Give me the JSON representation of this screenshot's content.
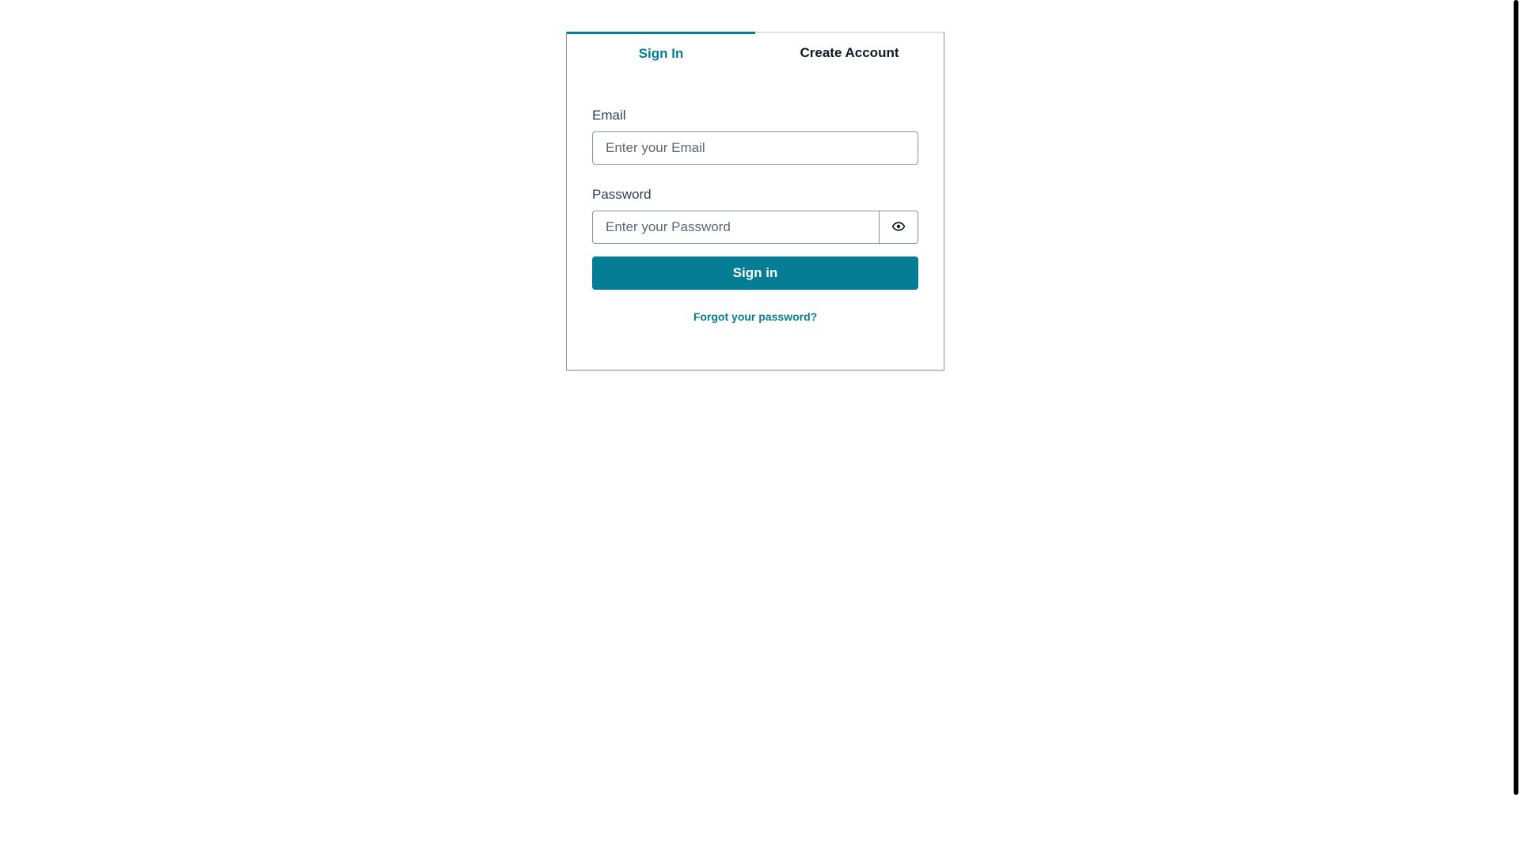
{
  "tabs": {
    "sign_in": "Sign In",
    "create_account": "Create Account"
  },
  "form": {
    "email_label": "Email",
    "email_placeholder": "Enter your Email",
    "password_label": "Password",
    "password_placeholder": "Enter your Password",
    "show_password_icon": "eye-icon",
    "submit_label": "Sign in",
    "forgot_password": "Forgot your password?"
  },
  "colors": {
    "primary": "#047d95",
    "border": "#89949f",
    "text": "#0d1a26"
  }
}
